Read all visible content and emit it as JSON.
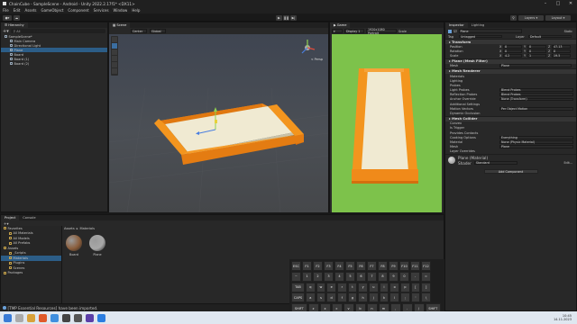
{
  "window": {
    "title": "ChainCube - SampleScene - Android - Unity 2022.2.17f1* <DX11>"
  },
  "menu": [
    "File",
    "Edit",
    "Assets",
    "GameObject",
    "Component",
    "Services",
    "Window",
    "Help"
  ],
  "toolbar": {
    "layers": "Layers",
    "layout": "Layout"
  },
  "hierarchy": {
    "tab": "Hierarchy",
    "search": "All",
    "items": [
      {
        "label": "SampleScene*",
        "indent": 0,
        "selected": false
      },
      {
        "label": "Main Camera",
        "indent": 1,
        "selected": false
      },
      {
        "label": "Directional Light",
        "indent": 1,
        "selected": false
      },
      {
        "label": "Plane",
        "indent": 1,
        "selected": true
      },
      {
        "label": "Board",
        "indent": 1,
        "selected": false
      },
      {
        "label": "Board (1)",
        "indent": 1,
        "selected": false
      },
      {
        "label": "Board (2)",
        "indent": 1,
        "selected": false
      }
    ]
  },
  "scene": {
    "tab": "Scene",
    "shading": "Center",
    "space": "Global",
    "persp": "< Persp"
  },
  "game": {
    "tab": "Game",
    "display": "Display 1",
    "resolution": "1920x1080 Portrait",
    "scale": "Scale"
  },
  "inspector": {
    "tabs": [
      "Inspector",
      "Lighting"
    ],
    "object_name": "Plane",
    "static": "Static",
    "tag_label": "Tag",
    "tag": "Untagged",
    "layer_label": "Layer",
    "layer": "Default",
    "transform": {
      "title": "Transform",
      "rows": [
        {
          "label": "Position",
          "x": "0",
          "y": "0",
          "z": "47.13"
        },
        {
          "label": "Rotation",
          "x": "0",
          "y": "0",
          "z": "0"
        },
        {
          "label": "Scale",
          "x": "4.2",
          "y": "1",
          "z": "19.5"
        }
      ]
    },
    "mesh_filter": {
      "title": "Plane (Mesh Filter)",
      "mesh_label": "Mesh",
      "mesh": "Plane"
    },
    "mesh_renderer": {
      "title": "Mesh Renderer",
      "rows": [
        {
          "label": "Materials",
          "value": ""
        },
        {
          "label": "Lighting",
          "value": ""
        },
        {
          "label": "Probes",
          "value": ""
        },
        {
          "label": "Light Probes",
          "value": "Blend Probes"
        },
        {
          "label": "Reflection Probes",
          "value": "Blend Probes"
        },
        {
          "label": "Anchor Override",
          "value": "None (Transform)"
        },
        {
          "label": "Additional Settings",
          "value": ""
        },
        {
          "label": "Motion Vectors",
          "value": "Per Object Motion"
        },
        {
          "label": "Dynamic Occlusion",
          "value": ""
        }
      ]
    },
    "mesh_collider": {
      "title": "Mesh Collider",
      "rows": [
        {
          "label": "Convex",
          "value": ""
        },
        {
          "label": "Is Trigger",
          "value": ""
        },
        {
          "label": "Provides Contacts",
          "value": ""
        },
        {
          "label": "Cooking Options",
          "value": "Everything"
        },
        {
          "label": "Material",
          "value": "None (Physic Material)"
        },
        {
          "label": "Mesh",
          "value": "Plane"
        },
        {
          "label": "Layer Overrides",
          "value": ""
        }
      ]
    },
    "material": {
      "name": "Plane (Material)",
      "shader_label": "Shader",
      "shader": "Standard",
      "edit": "Edit..."
    },
    "add_component": "Add Component"
  },
  "project": {
    "tabs": [
      "Project",
      "Console"
    ],
    "breadcrumb": [
      "Assets",
      "Materials"
    ],
    "tree": [
      {
        "label": "Favorites",
        "indent": 0
      },
      {
        "label": "All Materials",
        "indent": 1
      },
      {
        "label": "All Models",
        "indent": 1
      },
      {
        "label": "All Prefabs",
        "indent": 1
      },
      {
        "label": "Assets",
        "indent": 0
      },
      {
        "label": "_Scripts",
        "indent": 1
      },
      {
        "label": "Materials",
        "indent": 1,
        "selected": true
      },
      {
        "label": "Plugins",
        "indent": 1
      },
      {
        "label": "Scenes",
        "indent": 1
      },
      {
        "label": "Packages",
        "indent": 0
      }
    ],
    "assets": [
      {
        "name": "Board",
        "color": "#8a5d3b"
      },
      {
        "name": "Plane",
        "color": "#a8a8a8"
      }
    ]
  },
  "status": "[TMP Essential Resources] have been imported.",
  "keyboard": {
    "rows": [
      [
        "ESC",
        "F1",
        "F2",
        "F3",
        "F4",
        "F5",
        "F6",
        "F7",
        "F8",
        "F9",
        "F10",
        "F11",
        "F12"
      ],
      [
        "~",
        "1",
        "2",
        "3",
        "4",
        "5",
        "6",
        "7",
        "8",
        "9",
        "0",
        "-",
        "="
      ],
      [
        "TAB",
        "q",
        "w",
        "e",
        "r",
        "t",
        "y",
        "u",
        "i",
        "o",
        "p",
        "[",
        "]"
      ],
      [
        "CAPS",
        "a",
        "s",
        "d",
        "f",
        "g",
        "h",
        "j",
        "k",
        "l",
        ";",
        "'",
        "\\"
      ],
      [
        "SHIFT",
        "z",
        "x",
        "c",
        "v",
        "b",
        "n",
        "m",
        ",",
        ".",
        "/",
        "SHIFT"
      ],
      [
        "CTRL",
        "WIN",
        "ALT",
        "",
        "ALT",
        "WIN",
        "CTRL"
      ]
    ]
  },
  "clock": {
    "time": "10:45",
    "date": "14.11.2023"
  },
  "colors": {
    "board": "#f08a1a",
    "plane": "#f0ead2",
    "sky_green": "#7dc24b",
    "selection": "#2c5d87"
  }
}
